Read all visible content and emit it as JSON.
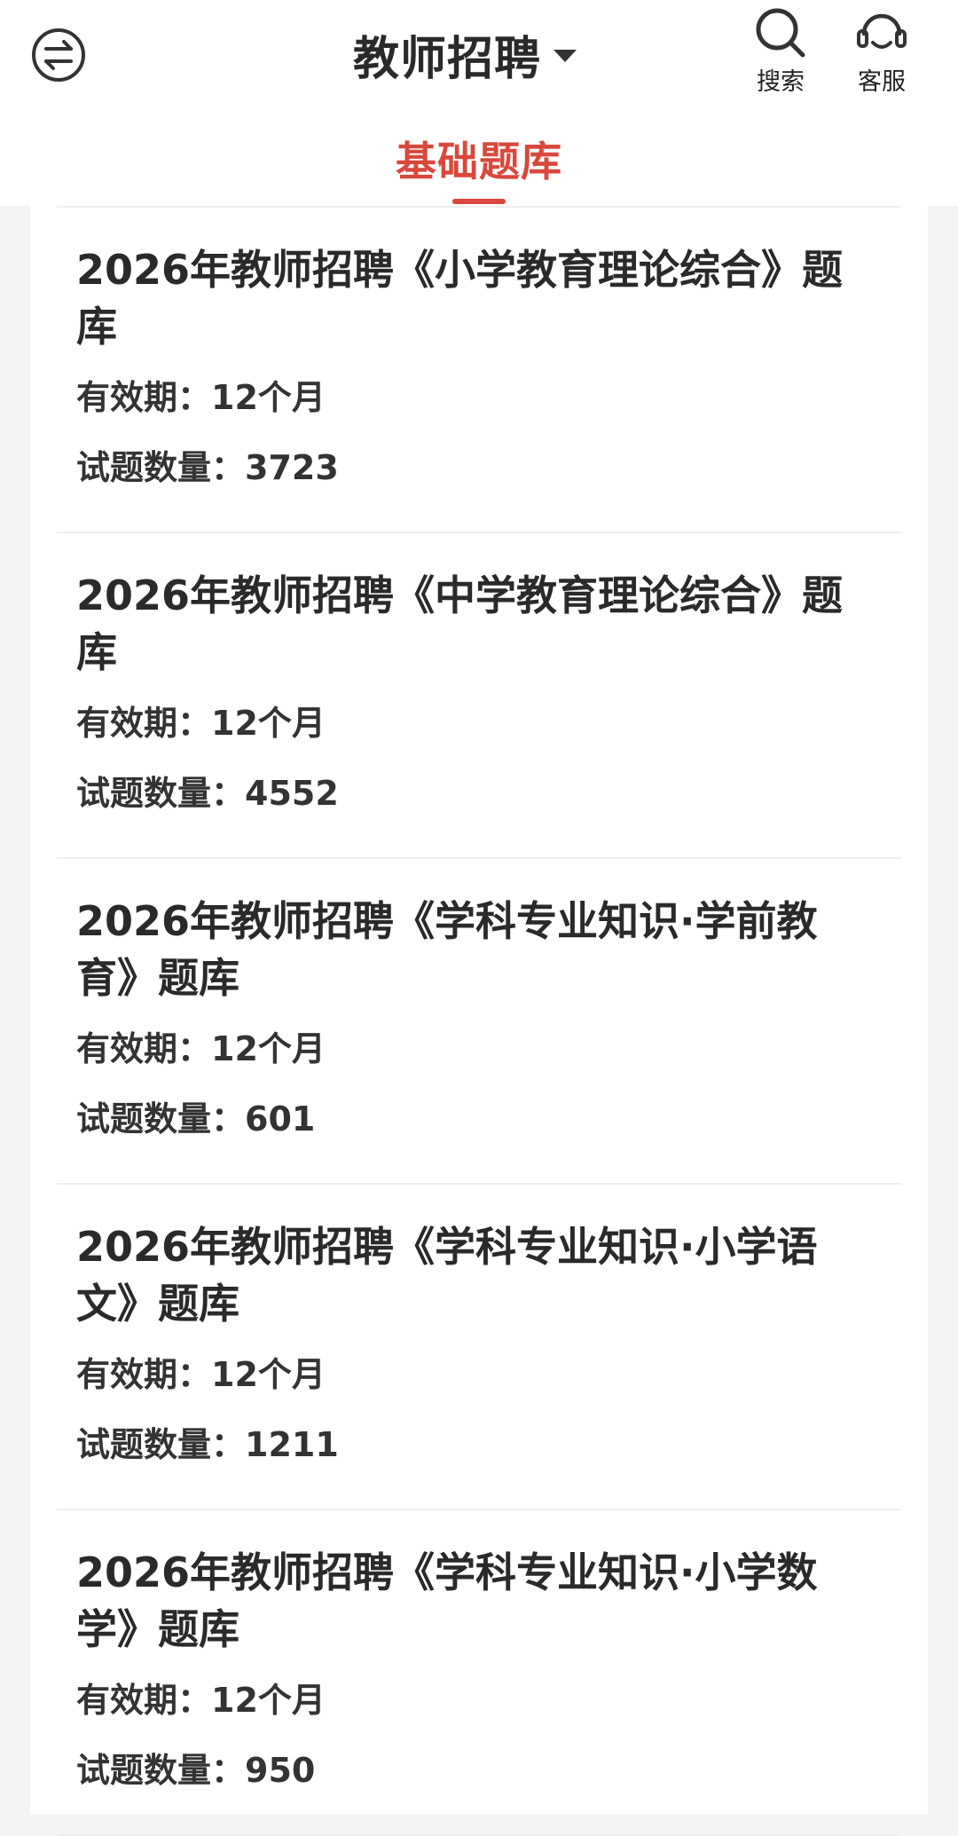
{
  "header": {
    "title": "教师招聘",
    "search_label": "搜索",
    "service_label": "客服",
    "menu_icon": "exchange-circle-icon",
    "search_icon": "search-icon",
    "service_icon": "headset-icon"
  },
  "tabs": [
    {
      "label": "基础题库",
      "active": true
    }
  ],
  "colors": {
    "accent": "#d9483b",
    "background": "#f4f4f4",
    "card": "#ffffff",
    "text": "#2a2a2a"
  },
  "items": [
    {
      "title": "2026年教师招聘《小学教育理论综合》题库",
      "validity": "有效期：12个月",
      "count": "试题数量：3723"
    },
    {
      "title": "2026年教师招聘《中学教育理论综合》题库",
      "validity": "有效期：12个月",
      "count": "试题数量：4552"
    },
    {
      "title": "2026年教师招聘《学科专业知识·学前教育》题库",
      "validity": "有效期：12个月",
      "count": "试题数量：601"
    },
    {
      "title": "2026年教师招聘《学科专业知识·小学语文》题库",
      "validity": "有效期：12个月",
      "count": "试题数量：1211"
    },
    {
      "title": "2026年教师招聘《学科专业知识·小学数学》题库",
      "validity": "有效期：12个月",
      "count": "试题数量：950"
    }
  ]
}
